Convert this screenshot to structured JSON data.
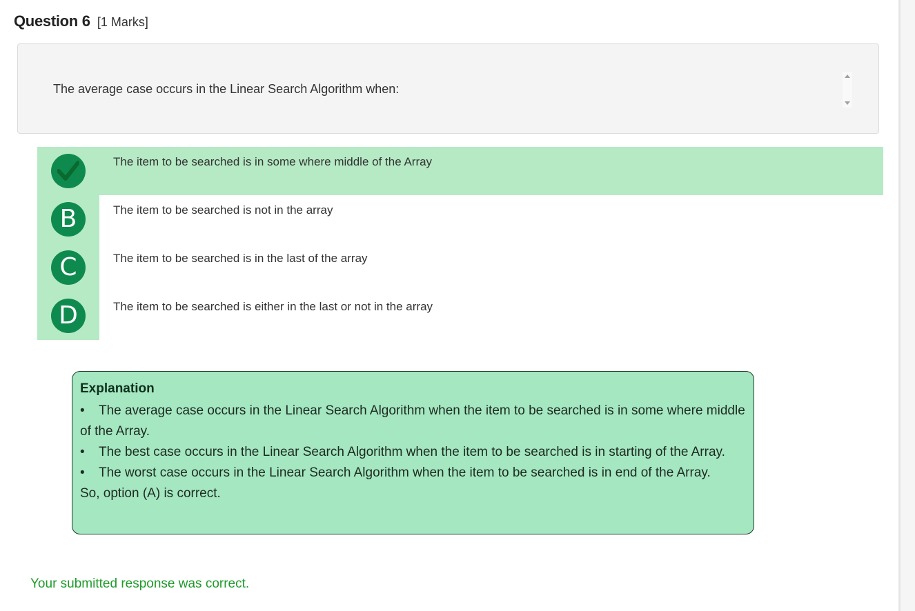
{
  "question": {
    "title": "Question 6",
    "marks": "[1 Marks]",
    "text": "The average case occurs in the Linear Search Algorithm when:"
  },
  "options": [
    {
      "letter": "A",
      "text": "The item to be searched is in some where middle of the Array",
      "status": "correct",
      "icon": "checkmark-icon"
    },
    {
      "letter": "B",
      "text": "The item to be searched is not in the array"
    },
    {
      "letter": "C",
      "text": "The item to be searched is in the last of the array"
    },
    {
      "letter": "D",
      "text": "The item to be searched is either in the last or not in the array"
    }
  ],
  "explanation": {
    "title": "Explanation",
    "bullets": [
      "The average case occurs in the Linear Search Algorithm when the item to be searched is in some where middle of the Array.",
      "The best case occurs in the Linear Search Algorithm when the item to be searched is in starting of the Array.",
      "The worst case occurs in the Linear Search Algorithm when the item to be searched is in end of the Array."
    ],
    "conclusion": "So, option (A) is correct."
  },
  "result": "Your submitted response was correct.",
  "colors": {
    "badge": "#0f8a4f",
    "correct_bg": "#b5eac5",
    "explanation_bg": "#a4e7c0",
    "result_text": "#1e9a2a"
  }
}
